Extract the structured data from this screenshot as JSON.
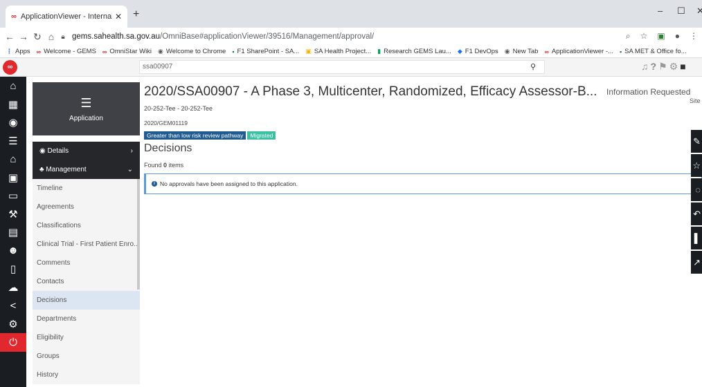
{
  "browser": {
    "tab_title": "ApplicationViewer - Internal Port",
    "url_host": "gems.sahealth.sa.gov.au",
    "url_path": "/OmniBase#applicationViewer/39516/Management/approval/",
    "bookmarks": [
      {
        "label": "Apps",
        "icon": "apps-icon"
      },
      {
        "label": "Welcome - GEMS",
        "icon": "gems-icon"
      },
      {
        "label": "OmniStar Wiki",
        "icon": "gems-icon"
      },
      {
        "label": "Welcome to Chrome",
        "icon": "chrome-icon"
      },
      {
        "label": "F1 SharePoint - SA...",
        "icon": "sharepoint-icon"
      },
      {
        "label": "SA Health Project...",
        "icon": "folder-icon"
      },
      {
        "label": "Research GEMS Lau...",
        "icon": "flag-icon"
      },
      {
        "label": "F1 DevOps",
        "icon": "devops-icon"
      },
      {
        "label": "New Tab",
        "icon": "chrome-icon"
      },
      {
        "label": "ApplicationViewer -...",
        "icon": "gems-icon"
      },
      {
        "label": "SA MET & Office fo...",
        "icon": "sharepoint-icon"
      }
    ]
  },
  "header": {
    "search_value": "ssa00907"
  },
  "appcard": {
    "label": "Application"
  },
  "sidebar": {
    "details": "Details",
    "management": "Management",
    "items": [
      "Timeline",
      "Agreements",
      "Classifications",
      "Clinical Trial - First Patient Enro...",
      "Comments",
      "Contacts",
      "Decisions",
      "Departments",
      "Eligibility",
      "Groups",
      "History"
    ],
    "active_index": 6
  },
  "main": {
    "title": "2020/SSA00907 - A Phase 3, Multicenter, Randomized, Efficacy Assessor-B...",
    "status": "Information Requested",
    "status_sub": "Site",
    "sub1": "20-252-Tee - 20-252-Tee",
    "sub2": "2020/GEM01119",
    "tags": [
      "Greater than low risk review pathway",
      "Migrated"
    ],
    "section_title": "Decisions",
    "found_prefix": "Found",
    "found_count": "0",
    "found_suffix": "items",
    "alert_text": "No approvals have been assigned to this application."
  },
  "colors": {
    "accent_red": "#e0282e",
    "rail_dark": "#1a1d21",
    "tag_blue": "#1f5a91",
    "tag_teal": "#3ac0a3",
    "active_item": "#dce6f3"
  }
}
